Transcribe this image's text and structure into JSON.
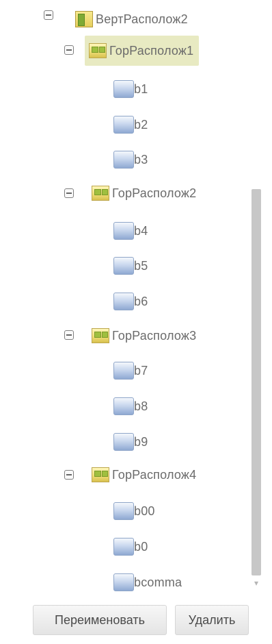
{
  "tree": {
    "root": {
      "label": "ВертРасполож2"
    },
    "groups": [
      {
        "label": "ГорРасполож1",
        "selected": true,
        "buttons": [
          "b1",
          "b2",
          "b3"
        ]
      },
      {
        "label": "ГорРасполож2",
        "selected": false,
        "buttons": [
          "b4",
          "b5",
          "b6"
        ]
      },
      {
        "label": "ГорРасполож3",
        "selected": false,
        "buttons": [
          "b7",
          "b8",
          "b9"
        ]
      },
      {
        "label": "ГорРасполож4",
        "selected": false,
        "buttons": [
          "b00",
          "b0",
          "bcomma"
        ]
      }
    ]
  },
  "actions": {
    "rename_label": "Переименовать",
    "delete_label": "Удалить"
  },
  "colors": {
    "selection": "#e8eac2",
    "text": "#6b6b6b",
    "scrollbar": "#c7c7c7"
  },
  "icons": {
    "vertical_arrangement": "vertical-arrangement-icon",
    "horizontal_arrangement": "horizontal-arrangement-icon",
    "button": "button-icon",
    "collapse": "collapse-toggle-icon"
  }
}
